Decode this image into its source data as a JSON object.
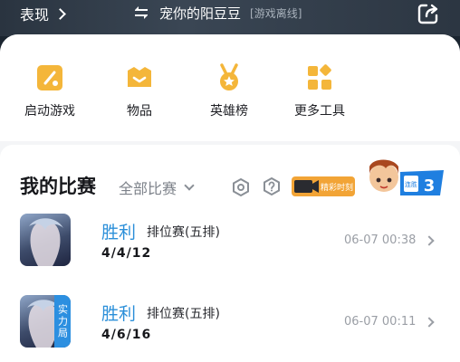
{
  "header": {
    "left_label": "表现",
    "player_name": "宠你的阳豆豆",
    "player_status": "[游戏离线]"
  },
  "tools": [
    {
      "label": "启动游戏",
      "icon": "launch-game-icon"
    },
    {
      "label": "物品",
      "icon": "items-icon"
    },
    {
      "label": "英雄榜",
      "icon": "medal-icon"
    },
    {
      "label": "更多工具",
      "icon": "more-tools-icon"
    }
  ],
  "matches": {
    "title": "我的比赛",
    "filter": "全部比赛",
    "highlight_badge": "精彩时刻",
    "streak_badge": "连胜",
    "streak_count": "3",
    "items": [
      {
        "result": "胜利",
        "mode": "排位赛(五排)",
        "kda": "4/4/12",
        "time": "06-07 00:38",
        "tag": ""
      },
      {
        "result": "胜利",
        "mode": "排位赛(五排)",
        "kda": "4/6/16",
        "time": "06-07 00:11",
        "tag": "实力局"
      }
    ]
  },
  "colors": {
    "accent_blue": "#2b8fd9",
    "icon_orange": "#f4b63a",
    "header_dark": "#2a3440"
  }
}
